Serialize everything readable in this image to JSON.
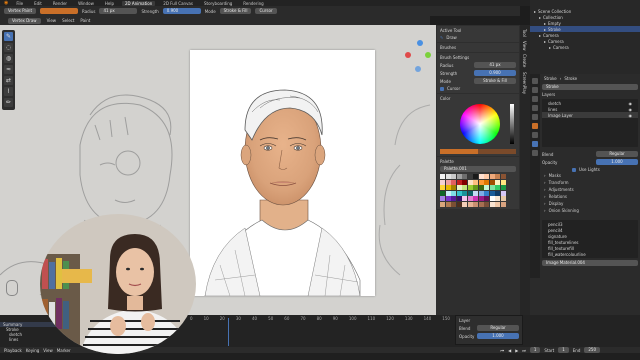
{
  "menubar": {
    "items": [
      "File",
      "Edit",
      "Render",
      "Window",
      "Help"
    ],
    "tabs": [
      "2D Animation",
      "2D Full Canvas",
      "Storyboarding",
      "Rendering"
    ],
    "active_tab": "2D Animation",
    "scene": "Scene",
    "view_layer": "View Layer"
  },
  "toolheader": {
    "mode": "Vertex Paint",
    "radius_label": "Radius",
    "radius_value": "41 px",
    "strength_label": "Strength",
    "strength_value": "0.900",
    "mode_label": "Mode",
    "mode_value": "Stroke & Fill",
    "cursor": "Cursor"
  },
  "vpheader": {
    "items": [
      "Vertex Draw",
      "View",
      "Select",
      "Paint"
    ]
  },
  "npanel": {
    "active_tool_title": "Active Tool",
    "tool_name": "Draw",
    "brushes_title": "Brushes",
    "brush_settings_title": "Brush Settings",
    "radius_label": "Radius",
    "radius_value": "41 px",
    "strength_label": "Strength",
    "strength_value": "0.900",
    "mode_label": "Mode",
    "mode_value": "Stroke & Fill",
    "cursor_label": "Cursor",
    "color_title": "Color",
    "palette_title": "Palette",
    "palette_name": "Palette.001"
  },
  "side_tabs": [
    "Tool",
    "View",
    "Create",
    "ScreenPlay"
  ],
  "outliner": {
    "items": [
      {
        "label": "Scene Collection",
        "indent": 0,
        "selected": false
      },
      {
        "label": "Collection",
        "indent": 1,
        "selected": false
      },
      {
        "label": "Empty",
        "indent": 2,
        "selected": false
      },
      {
        "label": "Stroke",
        "indent": 2,
        "selected": true
      },
      {
        "label": "Camera",
        "indent": 1,
        "selected": false
      },
      {
        "label": "Camera",
        "indent": 2,
        "selected": false
      },
      {
        "label": "Camera",
        "indent": 3,
        "selected": false
      }
    ]
  },
  "props": {
    "breadcrumb_object": "Stroke",
    "breadcrumb_data": "Stroke",
    "object_name": "Stroke",
    "layers_title": "Layers",
    "layers": [
      "sketch",
      "lines",
      "Image Layer"
    ],
    "selected_layer": "Image Layer",
    "blend_label": "Blend",
    "blend_value": "Regular",
    "opacity_label": "Opacity",
    "opacity_value": "1.000",
    "use_lights_label": "Use Lights",
    "panels": [
      "Masks",
      "Transform",
      "Adjustments",
      "Relations",
      "Display"
    ],
    "onion_label": "Onion Skinning",
    "materials": [
      "pencil3",
      "pencil4",
      "signature",
      "fill_texturelines",
      "fill_texturefill",
      "fill_watercolourline"
    ],
    "selected_material": "Image Material.004"
  },
  "timeline": {
    "summary_label": "Summary",
    "stroke_label": "Stroke",
    "sketch_label": "sketch",
    "layers_label": "lines",
    "frames": [
      "0",
      "10",
      "20",
      "30",
      "40",
      "50",
      "60",
      "70",
      "80",
      "90",
      "100",
      "110",
      "120",
      "130",
      "140",
      "150"
    ],
    "current_frame": "1",
    "start_label": "Start",
    "start_value": "1",
    "end_label": "End",
    "end_value": "250",
    "playback_label": "Playback",
    "keying_label": "Keying",
    "view_label": "View",
    "marker_label": "Marker",
    "layer_popup_title": "Layer",
    "layer_blend_label": "Blend",
    "layer_blend_value": "Regular",
    "layer_opacity_label": "Opacity",
    "layer_opacity_value": "1.000"
  },
  "colors": {
    "accent": "#4772b3",
    "orange": "#c96f28",
    "selected": "#334d80"
  },
  "palette_swatches": [
    "#f2f2f2",
    "#e0e0e0",
    "#c8c8c8",
    "#9e9e9e",
    "#6e6e6e",
    "#3a3a3a",
    "#1a1a1a",
    "#ffe0d0",
    "#ffcba8",
    "#f0a97a",
    "#c78150",
    "#8a5333",
    "#f5d2d2",
    "#f0a0a0",
    "#e06060",
    "#c02020",
    "#800000",
    "#ffe2c6",
    "#ffbf80",
    "#ff9933",
    "#e07700",
    "#a05000",
    "#fff3c4",
    "#ffe680",
    "#ffd633",
    "#e6b800",
    "#a38300",
    "#e8f5c6",
    "#c2e680",
    "#99cc33",
    "#66991a",
    "#3d6610",
    "#c6f5d6",
    "#80e6a3",
    "#33cc66",
    "#1a9944",
    "#106629",
    "#c6f0f5",
    "#80dde6",
    "#33c2cc",
    "#1a9199",
    "#106066",
    "#c6dbf5",
    "#80aee6",
    "#3380cc",
    "#1a5c99",
    "#103b66",
    "#d6c6f5",
    "#a380e6",
    "#7733cc",
    "#541a99",
    "#341066",
    "#f5c6ec",
    "#e680d2",
    "#cc33b3",
    "#991a86",
    "#661058",
    "#ffffff",
    "#f7e6d4",
    "#e8c9a8",
    "#d9a77c",
    "#b07b52",
    "#7a4f33",
    "#4d2f1e",
    "#f4cfb8",
    "#e5b394",
    "#c99071",
    "#a66f52",
    "#7a4e38",
    "#f9e4d2",
    "#f0c8a8",
    "#d9a37f"
  ]
}
